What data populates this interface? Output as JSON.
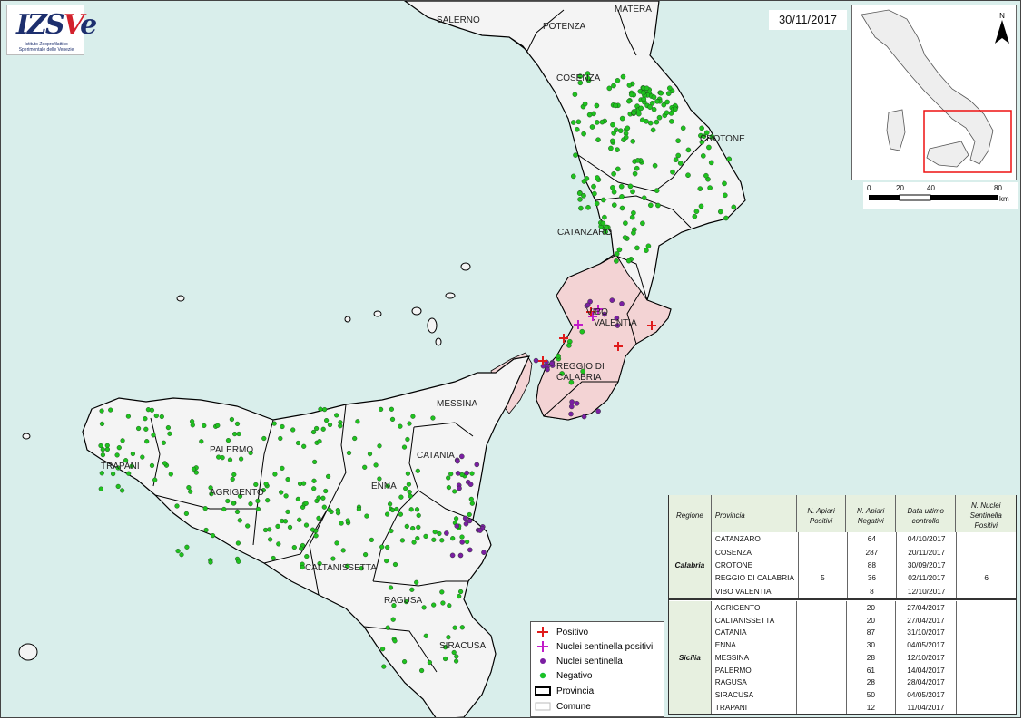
{
  "header": {
    "date": "30/11/2017",
    "logo_text": "IZSVe",
    "logo_subtitle": "Istituto Zooprofilattico Sperimentale delle Venezie"
  },
  "map": {
    "province_labels": [
      "SALERNO",
      "POTENZA",
      "MATERA",
      "COSENZA",
      "CROTONE",
      "CATANZARO",
      "VIBO VALENTIA",
      "REGGIO DI CALABRIA",
      "MESSINA",
      "PALERMO",
      "TRAPANI",
      "AGRIGENTO",
      "ENNA",
      "CATANIA",
      "CALTANISSETTA",
      "RAGUSA",
      "SIRACUSA"
    ],
    "colors": {
      "sea": "#d9eeeb",
      "land": "#f4f4f4",
      "province_border": "#000000",
      "comune_border": "#b9b9b9",
      "infected_area": "#f3d3d4",
      "negativo": "#1fc21f",
      "nuclei_sentinella": "#7b1fa2",
      "positivo": "#e01b1b",
      "nuclei_positivi": "#c21cc9"
    }
  },
  "scalebar": {
    "ticks": [
      "0",
      "20",
      "40",
      "80"
    ],
    "unit": "km"
  },
  "north": {
    "label": "N"
  },
  "legend": {
    "items": [
      {
        "label": "Positivo",
        "icon": "red-cross"
      },
      {
        "label": "Nuclei sentinella positivi",
        "icon": "magenta-cross"
      },
      {
        "label": "Nuclei sentinella",
        "icon": "purple-dot"
      },
      {
        "label": "Negativo",
        "icon": "green-dot"
      },
      {
        "label": "Provincia",
        "icon": "thick-box"
      },
      {
        "label": "Comune",
        "icon": "thin-box"
      }
    ]
  },
  "table": {
    "headers": {
      "regione": "Regione",
      "provincia": "Provincia",
      "positivi": "N. Apiari Positivi",
      "negativi": "N. Apiari Negativi",
      "data": "Data ultimo controllo",
      "sentinella": "N. Nuclei Sentinella Positivi"
    },
    "calabria": {
      "region": "Calabria",
      "positivi": "5",
      "sentinella": "6",
      "rows": [
        {
          "provincia": "CATANZARO",
          "negativi": "64",
          "data": "04/10/2017"
        },
        {
          "provincia": "COSENZA",
          "negativi": "287",
          "data": "20/11/2017"
        },
        {
          "provincia": "CROTONE",
          "negativi": "88",
          "data": "30/09/2017"
        },
        {
          "provincia": "REGGIO DI CALABRIA",
          "negativi": "36",
          "data": "02/11/2017"
        },
        {
          "provincia": "VIBO VALENTIA",
          "negativi": "8",
          "data": "12/10/2017"
        }
      ]
    },
    "sicilia": {
      "region": "Sicilia",
      "rows": [
        {
          "provincia": "AGRIGENTO",
          "negativi": "20",
          "data": "27/04/2017"
        },
        {
          "provincia": "CALTANISSETTA",
          "negativi": "20",
          "data": "27/04/2017"
        },
        {
          "provincia": "CATANIA",
          "negativi": "87",
          "data": "31/10/2017"
        },
        {
          "provincia": "ENNA",
          "negativi": "30",
          "data": "04/05/2017"
        },
        {
          "provincia": "MESSINA",
          "negativi": "28",
          "data": "12/10/2017"
        },
        {
          "provincia": "PALERMO",
          "negativi": "61",
          "data": "14/04/2017"
        },
        {
          "provincia": "RAGUSA",
          "negativi": "28",
          "data": "28/04/2017"
        },
        {
          "provincia": "SIRACUSA",
          "negativi": "50",
          "data": "04/05/2017"
        },
        {
          "provincia": "TRAPANI",
          "negativi": "12",
          "data": "11/04/2017"
        }
      ]
    }
  }
}
